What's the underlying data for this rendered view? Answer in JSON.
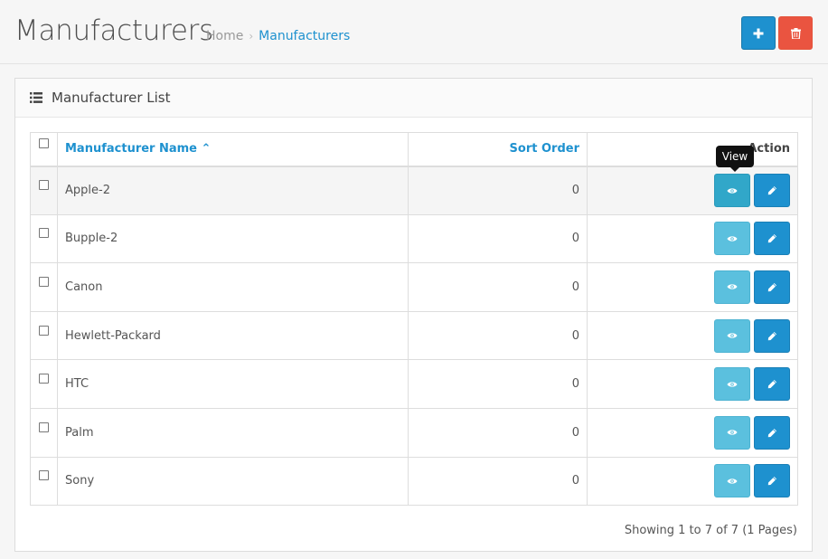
{
  "header": {
    "title": "Manufacturers",
    "breadcrumb": {
      "home": "Home",
      "separator": "›",
      "current": "Manufacturers"
    },
    "add_icon": "plus-icon",
    "delete_icon": "trash-icon"
  },
  "panel": {
    "icon": "list-icon",
    "title": "Manufacturer List"
  },
  "table": {
    "columns": {
      "name": "Manufacturer Name",
      "sort_order": "Sort Order",
      "action": "Action"
    },
    "sort_indicator": "⌃",
    "rows": [
      {
        "name": "Apple-2",
        "sort_order": "0"
      },
      {
        "name": "Bupple-2",
        "sort_order": "0"
      },
      {
        "name": "Canon",
        "sort_order": "0"
      },
      {
        "name": "Hewlett-Packard",
        "sort_order": "0"
      },
      {
        "name": "HTC",
        "sort_order": "0"
      },
      {
        "name": "Palm",
        "sort_order": "0"
      },
      {
        "name": "Sony",
        "sort_order": "0"
      }
    ]
  },
  "tooltip": "View",
  "pagination": {
    "summary": "Showing 1 to 7 of 7 (1 Pages)"
  },
  "colors": {
    "primary": "#1e91cf",
    "info": "#5bc0de",
    "danger": "#ea5440"
  }
}
